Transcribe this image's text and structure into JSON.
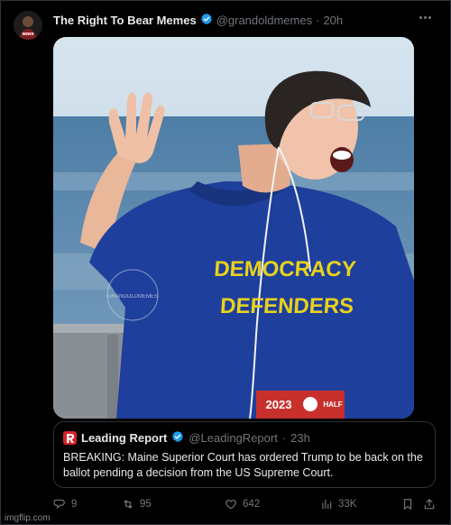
{
  "post": {
    "display_name": "The Right To Bear Memes",
    "handle": "@grandoldmemes",
    "separator": "·",
    "timestamp": "20h",
    "avatar_text": "TRTB"
  },
  "media": {
    "shirt_line1": "DEMOCRACY",
    "shirt_line2": "DEFENDERS",
    "bib_number": "2023",
    "bib_label": "HALF",
    "watermark": "GRANDOLDMEMES"
  },
  "quote": {
    "name": "Leading Report",
    "handle": "@LeadingReport",
    "separator": "·",
    "timestamp": "23h",
    "text": "BREAKING: Maine Superior Court has ordered Trump to be back on the ballot pending a decision from the US Supreme Court."
  },
  "actions": {
    "replies": "9",
    "retweets": "95",
    "likes": "642",
    "views": "33K"
  },
  "site_watermark": "imgflip.com",
  "colors": {
    "verified": "#1d9bf0",
    "muted": "#71767b",
    "border": "#2f3336",
    "shirt_text": "#e8d21c",
    "shirt": "#1f3f9c",
    "logo": "#d8232a"
  },
  "icons": {
    "verified": "verified-badge-icon",
    "more": "more-dots-icon",
    "reply": "reply-bubble-icon",
    "retweet": "retweet-arrows-icon",
    "like": "heart-icon",
    "views": "analytics-bars-icon",
    "bookmark": "bookmark-icon",
    "share": "share-upload-icon"
  }
}
